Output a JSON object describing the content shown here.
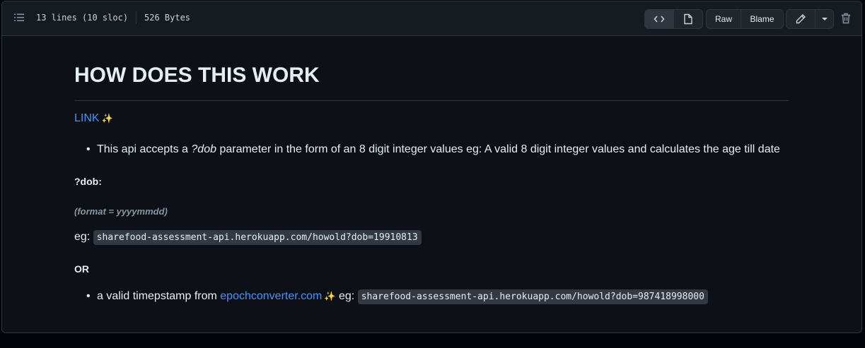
{
  "header": {
    "lines_info": "13 lines (10 sloc)",
    "size_info": "526 Bytes",
    "raw_label": "Raw",
    "blame_label": "Blame"
  },
  "readme": {
    "title": "HOW DOES THIS WORK",
    "link_text": "LINK",
    "sparkle": "✨",
    "bullet1": {
      "before": "This api accepts a ",
      "param": "?dob",
      "after": " parameter in the form of an 8 digit integer values eg: A valid 8 digit integer values and calculates the age till date"
    },
    "dob_label": "?dob:",
    "format_note": "(format = yyyymmdd)",
    "eg_label": "eg:",
    "example_url_1": "sharefood-assessment-api.herokuapp.com/howold?dob=19910813",
    "or_label": "OR",
    "bullet2": {
      "before": "a valid timepstamp from ",
      "link": "epochconverter.com",
      "eg": " eg: ",
      "code": "sharefood-assessment-api.herokuapp.com/howold?dob=987418998000"
    }
  }
}
